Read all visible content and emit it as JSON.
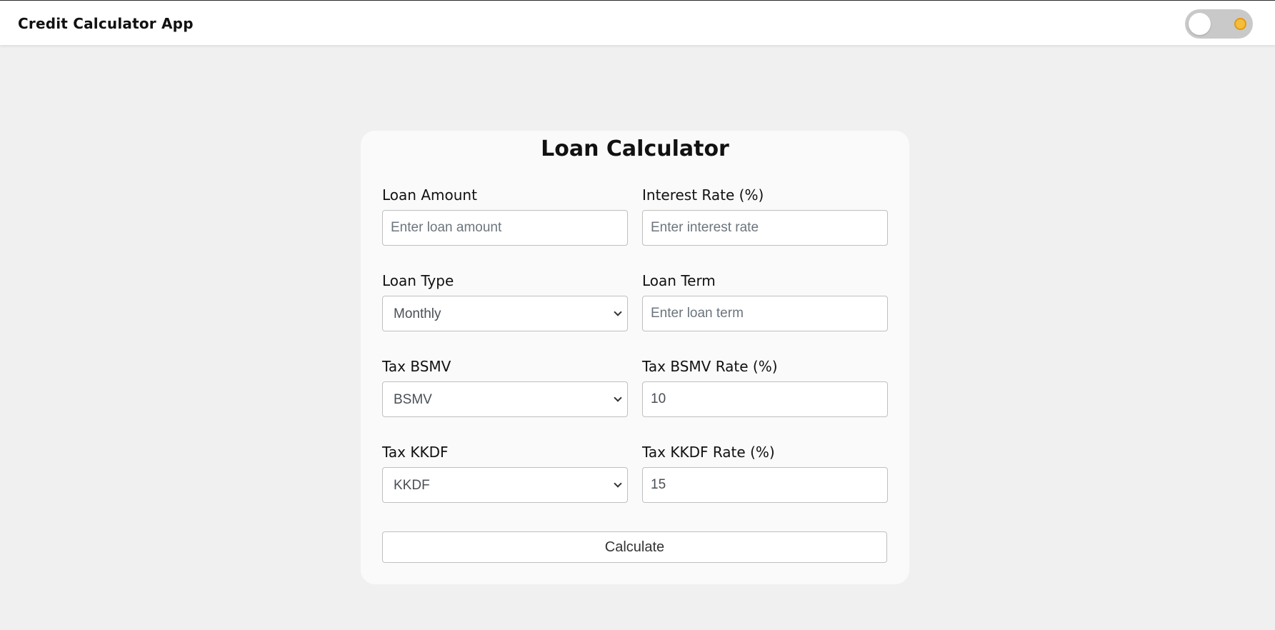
{
  "header": {
    "app_title": "Credit Calculator App",
    "theme_toggle": {
      "state": "light",
      "icon": "sun-icon",
      "sun_color": "#f6bd3a"
    }
  },
  "form": {
    "title": "Loan Calculator",
    "fields": {
      "loan_amount": {
        "label": "Loan Amount",
        "placeholder": "Enter loan amount",
        "value": ""
      },
      "interest_rate": {
        "label": "Interest Rate (%)",
        "placeholder": "Enter interest rate",
        "value": ""
      },
      "loan_type": {
        "label": "Loan Type",
        "selected": "Monthly"
      },
      "loan_term": {
        "label": "Loan Term",
        "placeholder": "Enter loan term",
        "value": ""
      },
      "tax_bsmv": {
        "label": "Tax BSMV",
        "selected": "BSMV"
      },
      "tax_bsmv_rate": {
        "label": "Tax BSMV Rate (%)",
        "value": "10"
      },
      "tax_kkdf": {
        "label": "Tax KKDF",
        "selected": "KKDF"
      },
      "tax_kkdf_rate": {
        "label": "Tax KKDF Rate (%)",
        "value": "15"
      }
    },
    "calculate_label": "Calculate"
  }
}
